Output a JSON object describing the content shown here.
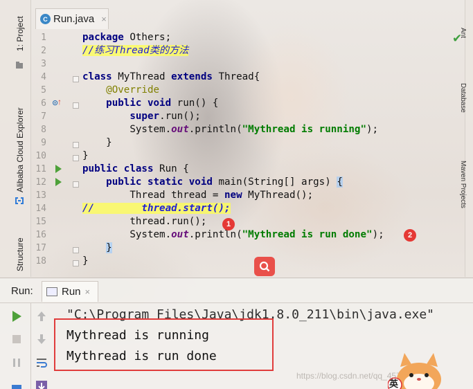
{
  "left_toolbar": {
    "project": "1: Project",
    "cloud": "Alibaba Cloud Explorer",
    "structure": "Structure"
  },
  "right_toolbar": {
    "items": [
      "Ant",
      "Database",
      "Maven Projects"
    ]
  },
  "editor": {
    "tab_label": "Run.java",
    "tab_icon_letter": "C",
    "tab_close": "×",
    "line_numbers": [
      "1",
      "2",
      "3",
      "4",
      "5",
      "6",
      "7",
      "8",
      "9",
      "10",
      "11",
      "12",
      "13",
      "14",
      "15",
      "16",
      "17",
      "18"
    ],
    "code": {
      "l1": {
        "kw": "package",
        "rest": " Others;"
      },
      "l2": {
        "comment": "//练习Thread类的方法"
      },
      "l4": {
        "kw1": "class",
        "mid1": " MyThread ",
        "kw2": "extends",
        "rest": " Thread{"
      },
      "l5": {
        "ann": "@Override"
      },
      "l6": {
        "kw1": "public",
        "kw2": "void",
        "rest": " run() {"
      },
      "l7": {
        "kw": "super",
        "rest": ".run();"
      },
      "l8": {
        "pre": "System.",
        "field": "out",
        "mid": ".println(",
        "str": "\"Mythread is running\"",
        "post": ");"
      },
      "l9": {
        "text": "}"
      },
      "l10": {
        "text": "}"
      },
      "l11": {
        "kw1": "public",
        "kw2": "class",
        "rest": " Run {"
      },
      "l12": {
        "kw1": "public",
        "kw2": "static",
        "kw3": "void",
        "rest": " main(String[] args) ",
        "brace": "{"
      },
      "l13": {
        "pre": "Thread thread = ",
        "kw": "new",
        "rest": " MyThread();"
      },
      "l14": {
        "comment": "//        thread.start();"
      },
      "l15": {
        "text": "thread.run();"
      },
      "l16": {
        "pre": "System.",
        "field": "out",
        "mid": ".println(",
        "str": "\"Mythread is run done\"",
        "post": ");"
      },
      "l17": {
        "text": "}"
      },
      "l18": {
        "text": "}"
      }
    },
    "badges": [
      "1",
      "2"
    ]
  },
  "run_panel": {
    "title": "Run:",
    "tab_label": "Run",
    "tab_close": "×",
    "console": [
      "\"C:\\Program Files\\Java\\jdk1.8.0_211\\bin\\java.exe\"",
      "Mythread is running",
      "Mythread is run done"
    ]
  },
  "watermark": "https://blog.csdn.net/qq_45710168",
  "mascot_label": "英",
  "colors": {
    "keyword": "#000080",
    "string": "#007c00",
    "annotation": "#808000",
    "comment": "#1f1fd6",
    "field": "#660e7a",
    "badge": "#e53935",
    "run_green": "#4ea13a"
  }
}
